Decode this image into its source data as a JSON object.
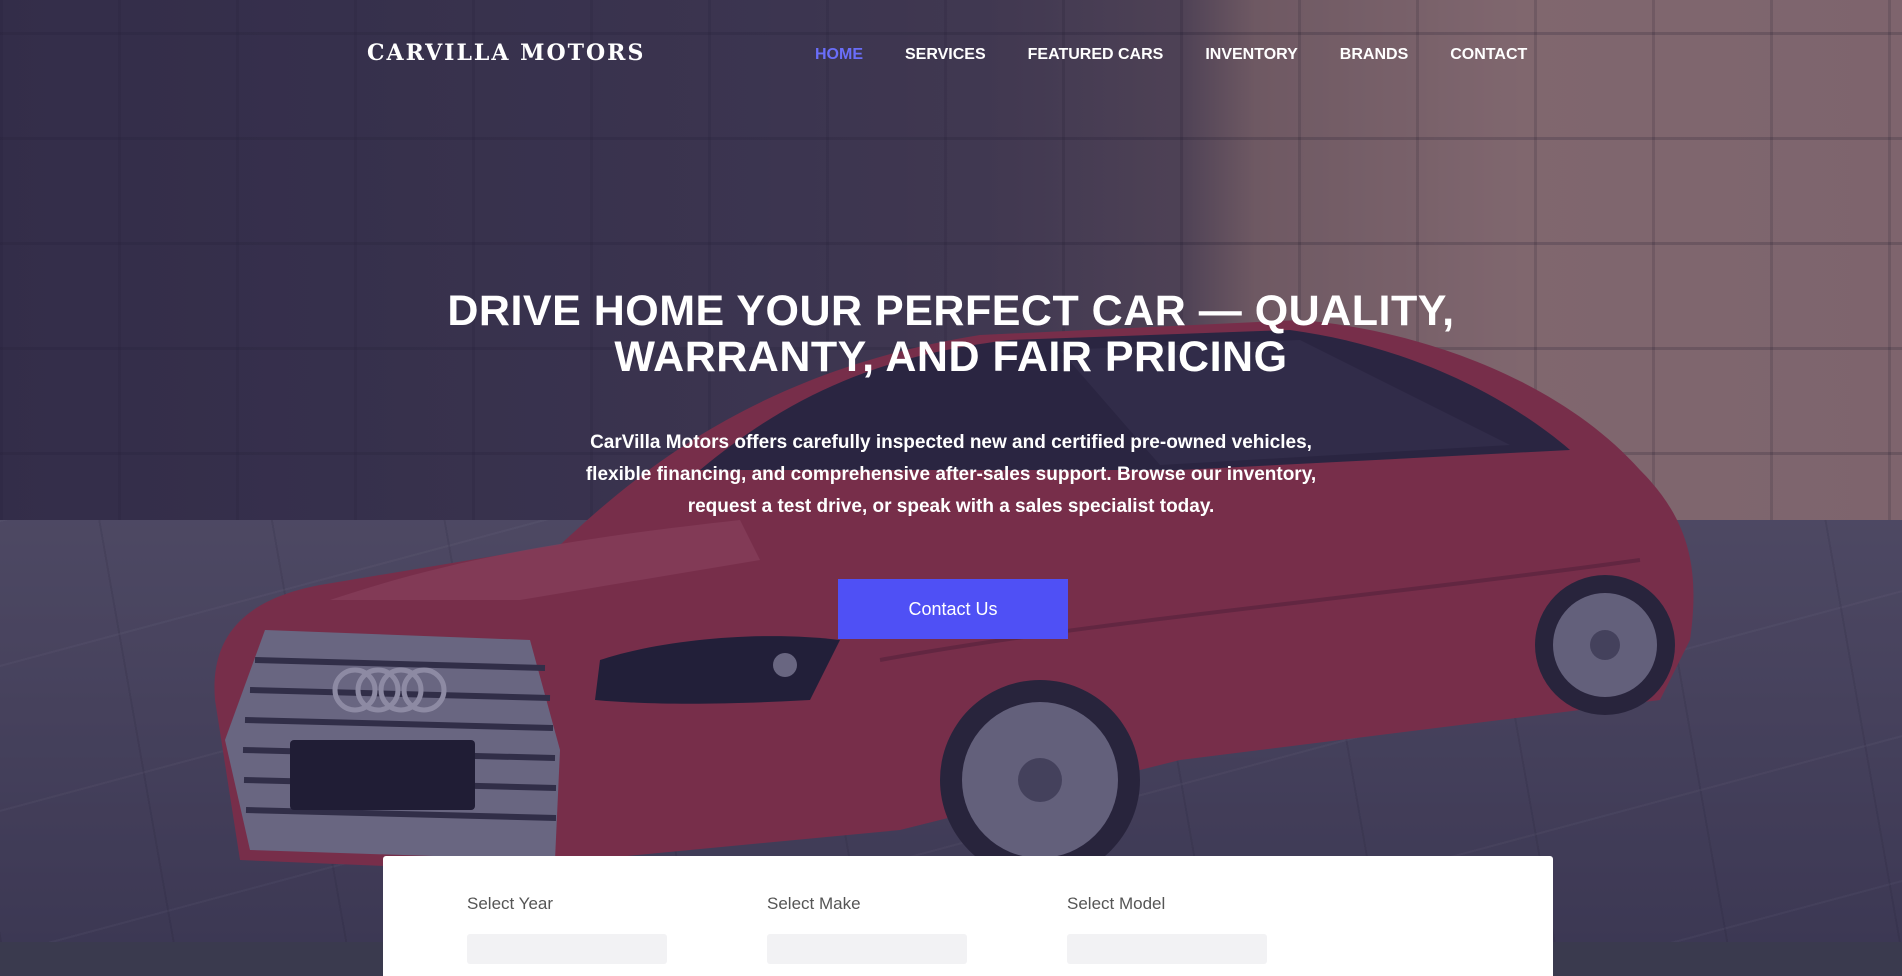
{
  "brand": {
    "logo": "CARVILLA MOTORS"
  },
  "nav": {
    "items": [
      {
        "label": "HOME",
        "active": true
      },
      {
        "label": "SERVICES"
      },
      {
        "label": "FEATURED CARS"
      },
      {
        "label": "INVENTORY"
      },
      {
        "label": "BRANDS"
      },
      {
        "label": "CONTACT"
      }
    ]
  },
  "hero": {
    "headline_line1": "DRIVE HOME YOUR PERFECT CAR — QUALITY,",
    "headline_line2": "WARRANTY, AND FAIR PRICING",
    "subtext_line1": "CarVilla Motors offers carefully inspected new and certified pre-owned vehicles,",
    "subtext_line2": "flexible financing, and comprehensive after-sales support. Browse our inventory,",
    "subtext_line3": "request a test drive, or speak with a sales specialist today.",
    "cta_label": "Contact Us"
  },
  "search": {
    "year_label": "Select Year",
    "make_label": "Select Make",
    "model_label": "Select Model"
  },
  "colors": {
    "accent": "#4f50f5",
    "nav_active": "#6a6ef9",
    "overlay": "#26204e"
  }
}
